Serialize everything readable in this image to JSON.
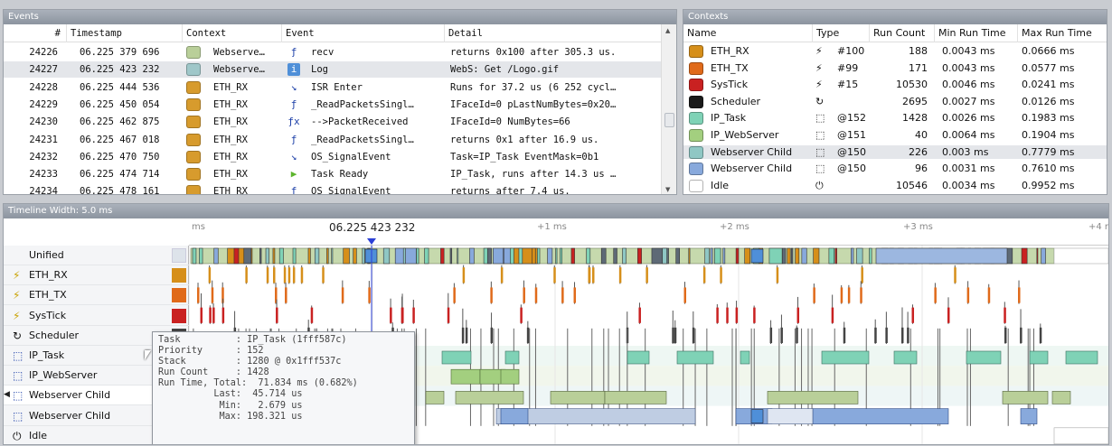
{
  "events": {
    "title": "Events",
    "columns": [
      "#",
      "Timestamp",
      "Context",
      "Event",
      "Detail"
    ],
    "rows": [
      {
        "num": "24226",
        "ts": "06.225 379 696",
        "ctx": "Webserve…",
        "color": "#b9cf99",
        "icon": "api-icon",
        "ev": "recv",
        "detail": "returns 0x100 after 305.3 us."
      },
      {
        "num": "24227",
        "ts": "06.225 423 232",
        "ctx": "Webserve…",
        "color": "#9fc7c9",
        "icon": "info-icon",
        "ev": "Log",
        "detail": "WebS: Get /Logo.gif"
      },
      {
        "num": "24228",
        "ts": "06.225 444 536",
        "ctx": "ETH_RX",
        "color": "#d79b2d",
        "icon": "isr-enter-icon",
        "ev": "ISR Enter",
        "detail": "Runs for 37.2 us (6 252 cycl…"
      },
      {
        "num": "24229",
        "ts": "06.225 450 054",
        "ctx": "ETH_RX",
        "color": "#d79b2d",
        "icon": "api-icon",
        "ev": "_ReadPacketsSingl…",
        "detail": "IFaceId=0 pLastNumBytes=0x20…"
      },
      {
        "num": "24230",
        "ts": "06.225 462 875",
        "ctx": "ETH_RX",
        "color": "#d79b2d",
        "icon": "function-icon",
        "ev": "-->PacketReceived",
        "detail": "IFaceId=0 NumBytes=66"
      },
      {
        "num": "24231",
        "ts": "06.225 467 018",
        "ctx": "ETH_RX",
        "color": "#d79b2d",
        "icon": "api-icon",
        "ev": "_ReadPacketsSingl…",
        "detail": "returns 0x1 after 16.9 us."
      },
      {
        "num": "24232",
        "ts": "06.225 470 750",
        "ctx": "ETH_RX",
        "color": "#d79b2d",
        "icon": "isr-enter-icon",
        "ev": "OS_SignalEvent",
        "detail": "Task=IP_Task EventMask=0b1"
      },
      {
        "num": "24233",
        "ts": "06.225 474 714",
        "ctx": "ETH_RX",
        "color": "#d79b2d",
        "icon": "task-ready-icon",
        "ev": "Task Ready",
        "detail": "IP_Task, runs after 14.3 us …"
      },
      {
        "num": "24234",
        "ts": "06.225 478 161",
        "ctx": "ETH_RX",
        "color": "#d79b2d",
        "icon": "api-icon",
        "ev": "OS_SignalEvent",
        "detail": "returns after 7.4 us."
      }
    ]
  },
  "contexts": {
    "title": "Contexts",
    "columns": [
      "Name",
      "Type",
      "Run Count",
      "Min Run Time",
      "Max Run Time"
    ],
    "rows": [
      {
        "name": "ETH_RX",
        "color": "#d68f1a",
        "type_icon": "⚡",
        "type": "#100",
        "runs": "188",
        "min": "0.0043 ms",
        "max": "0.0666 ms"
      },
      {
        "name": "ETH_TX",
        "color": "#e06a1a",
        "type_icon": "⚡",
        "type": "#99",
        "runs": "171",
        "min": "0.0043 ms",
        "max": "0.0577 ms"
      },
      {
        "name": "SysTick",
        "color": "#c92121",
        "type_icon": "⚡",
        "type": "#15",
        "runs": "10530",
        "min": "0.0046 ms",
        "max": "0.0241 ms"
      },
      {
        "name": "Scheduler",
        "color": "#1a1a1a",
        "type_icon": "↻",
        "type": "",
        "runs": "2695",
        "min": "0.0027 ms",
        "max": "0.0126 ms"
      },
      {
        "name": "IP_Task",
        "color": "#7fd2b6",
        "type_icon": "⬚",
        "type": "@152",
        "runs": "1428",
        "min": "0.0026 ms",
        "max": "0.1983 ms"
      },
      {
        "name": "IP_WebServer",
        "color": "#a3cf7f",
        "type_icon": "⬚",
        "type": "@151",
        "runs": "40",
        "min": "0.0064 ms",
        "max": "0.1904 ms"
      },
      {
        "name": "Webserver Child",
        "color": "#8fc7c4",
        "type_icon": "⬚",
        "type": "@150",
        "runs": "226",
        "min": "0.003 ms",
        "max": "0.7779 ms"
      },
      {
        "name": "Webserver Child",
        "color": "#88a9dc",
        "type_icon": "⬚",
        "type": "@150",
        "runs": "96",
        "min": "0.0031 ms",
        "max": "0.7610 ms"
      },
      {
        "name": "Idle",
        "color": "#ffffff",
        "type_icon": "⏻",
        "type": "",
        "runs": "10546",
        "min": "0.0034 ms",
        "max": "0.9952 ms"
      }
    ]
  },
  "timeline": {
    "title": "Timeline  Width:  5.0 ms",
    "ruler": {
      "start": "ms",
      "cursor": "06.225 423 232",
      "t1": "+1 ms",
      "t2": "+2 ms",
      "t3": "+3 ms",
      "t4": "+4 r"
    },
    "rows": [
      {
        "name": "Unified",
        "icon": "",
        "color": "#dde3ea"
      },
      {
        "name": "ETH_RX",
        "icon": "⚡",
        "color": "#d68f1a"
      },
      {
        "name": "ETH_TX",
        "icon": "⚡",
        "color": "#e06a1a"
      },
      {
        "name": "SysTick",
        "icon": "⚡",
        "color": "#c92121"
      },
      {
        "name": "Scheduler",
        "icon": "↻",
        "color": "#444444"
      },
      {
        "name": "IP_Task",
        "icon": "⬚",
        "color": "#7fd2b6"
      },
      {
        "name": "IP_WebServer",
        "icon": "⬚",
        "color": "#a3cf7f"
      },
      {
        "name": "Webserver Child",
        "icon": "⬚",
        "color": "#8fc7c4"
      },
      {
        "name": "Webserver Child",
        "icon": "⬚",
        "color": "#88a9dc"
      },
      {
        "name": "Idle",
        "icon": "⏻",
        "color": "#ffffff"
      }
    ],
    "tooltip": "Task          : IP_Task (1fff587c)\nPriority      : 152\nStack         : 1280 @ 0x1fff537c\nRun Count     : 1428\nRun Time, Total:  71.834 ms (0.682%)\n          Last:  45.714 us\n           Min:   2.679 us\n           Max: 198.321 us"
  }
}
